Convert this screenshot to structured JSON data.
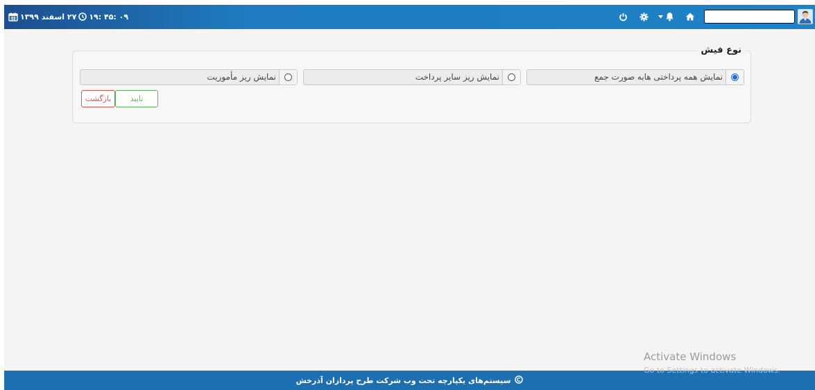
{
  "topbar": {
    "date_text": "۲۷ اسفند ۱۳۹۹",
    "time_text": "۰۹ :۴۵ :۱۹",
    "search_value": "",
    "icons": [
      "calendar-icon",
      "clock-icon",
      "power-icon",
      "gear-icon",
      "bell-icon",
      "home-icon",
      "avatar"
    ]
  },
  "form": {
    "legend": "نوع فیش",
    "options": [
      {
        "label": "نمایش همه پرداختی هابه صورت جمع",
        "checked": true
      },
      {
        "label": "نمایش ریز سایر پرداخت",
        "checked": false
      },
      {
        "label": "نمایش ریز مأموریت",
        "checked": false
      }
    ],
    "confirm_label": "تایید",
    "back_label": "بازگشت"
  },
  "footer": {
    "text": "سیستم‌های یکپارچه تحت وب شرکت طرح پردازان آذرخش"
  },
  "watermark": {
    "line1": "Activate Windows",
    "line2": "Go to Settings to activate Windows."
  },
  "colors": {
    "topbar": "#1f82c6",
    "footer": "#1d6fb0",
    "confirm": "#5cb85c",
    "back": "#d9534f",
    "radio_checked": "#1f6fd6"
  }
}
